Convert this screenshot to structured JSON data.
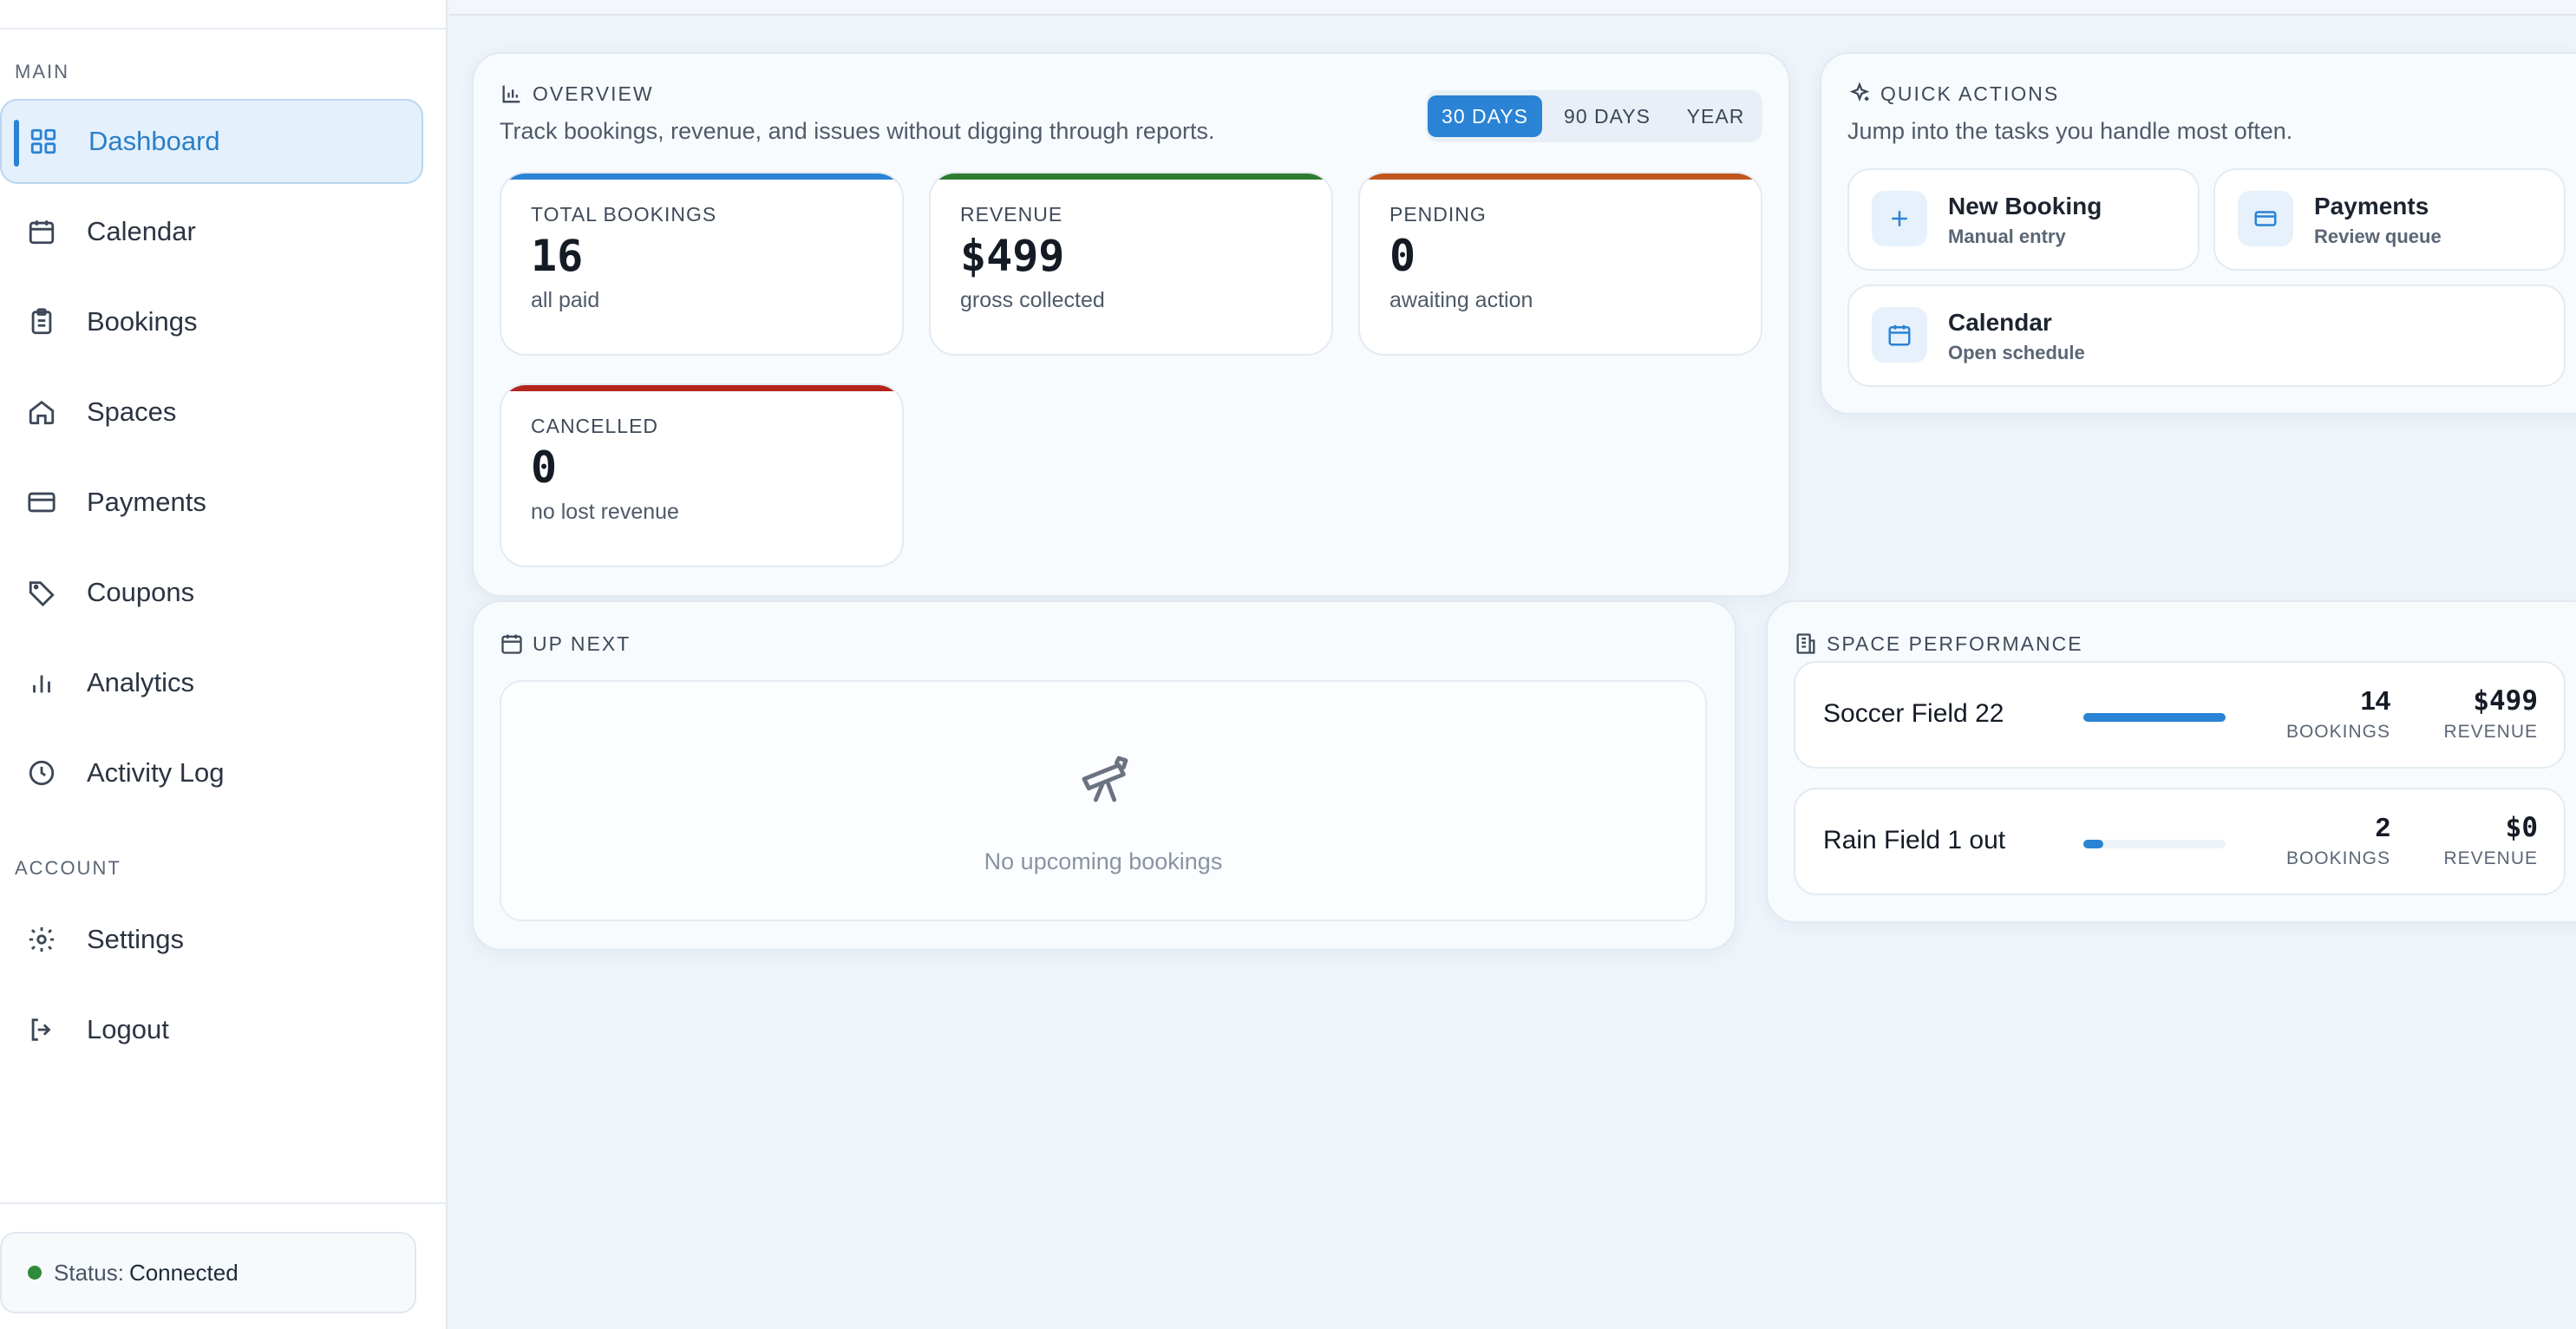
{
  "sidebar": {
    "section_main": "MAIN",
    "section_account": "ACCOUNT",
    "items": [
      {
        "label": "Dashboard",
        "icon": "grid-icon"
      },
      {
        "label": "Calendar",
        "icon": "calendar-icon"
      },
      {
        "label": "Bookings",
        "icon": "clipboard-icon"
      },
      {
        "label": "Spaces",
        "icon": "home-icon"
      },
      {
        "label": "Payments",
        "icon": "credit-card-icon"
      },
      {
        "label": "Coupons",
        "icon": "tag-icon"
      },
      {
        "label": "Analytics",
        "icon": "bar-chart-icon"
      },
      {
        "label": "Activity Log",
        "icon": "clock-icon"
      }
    ],
    "account_items": [
      {
        "label": "Settings",
        "icon": "gear-icon"
      },
      {
        "label": "Logout",
        "icon": "logout-icon"
      }
    ],
    "status": {
      "label": "Status:",
      "value": "Connected",
      "color": "#2e8b3a"
    }
  },
  "overview": {
    "title": "OVERVIEW",
    "subtitle": "Track bookings, revenue, and issues without digging through reports.",
    "ranges": [
      "30 DAYS",
      "90 DAYS",
      "YEAR"
    ],
    "active_range": "30 DAYS",
    "stats": [
      {
        "label": "TOTAL BOOKINGS",
        "value": "16",
        "hint": "all paid",
        "color": "#2a83d4"
      },
      {
        "label": "REVENUE",
        "value": "$499",
        "hint": "gross collected",
        "color": "#2e7d32"
      },
      {
        "label": "PENDING",
        "value": "0",
        "hint": "awaiting action",
        "color": "#c0561c"
      },
      {
        "label": "CANCELLED",
        "value": "0",
        "hint": "no lost revenue",
        "color": "#b3261e"
      }
    ]
  },
  "quick_actions": {
    "title": "QUICK ACTIONS",
    "subtitle": "Jump into the tasks you handle most often.",
    "items": [
      {
        "title": "New Booking",
        "sub": "Manual entry",
        "icon": "plus-icon"
      },
      {
        "title": "Payments",
        "sub": "Review queue",
        "icon": "credit-card-icon"
      },
      {
        "title": "Calendar",
        "sub": "Open schedule",
        "icon": "calendar-icon"
      }
    ]
  },
  "up_next": {
    "title": "UP NEXT",
    "empty_text": "No upcoming bookings",
    "empty_icon": "telescope-icon"
  },
  "space_performance": {
    "title": "SPACE PERFORMANCE",
    "rows": [
      {
        "name": "Soccer Field 22",
        "bookings": "14",
        "bookings_label": "BOOKINGS",
        "revenue": "$499",
        "revenue_label": "REVENUE",
        "share": 1.0
      },
      {
        "name": "Rain Field 1 out",
        "bookings": "2",
        "bookings_label": "BOOKINGS",
        "revenue": "$0",
        "revenue_label": "REVENUE",
        "share": 0.143
      }
    ]
  }
}
